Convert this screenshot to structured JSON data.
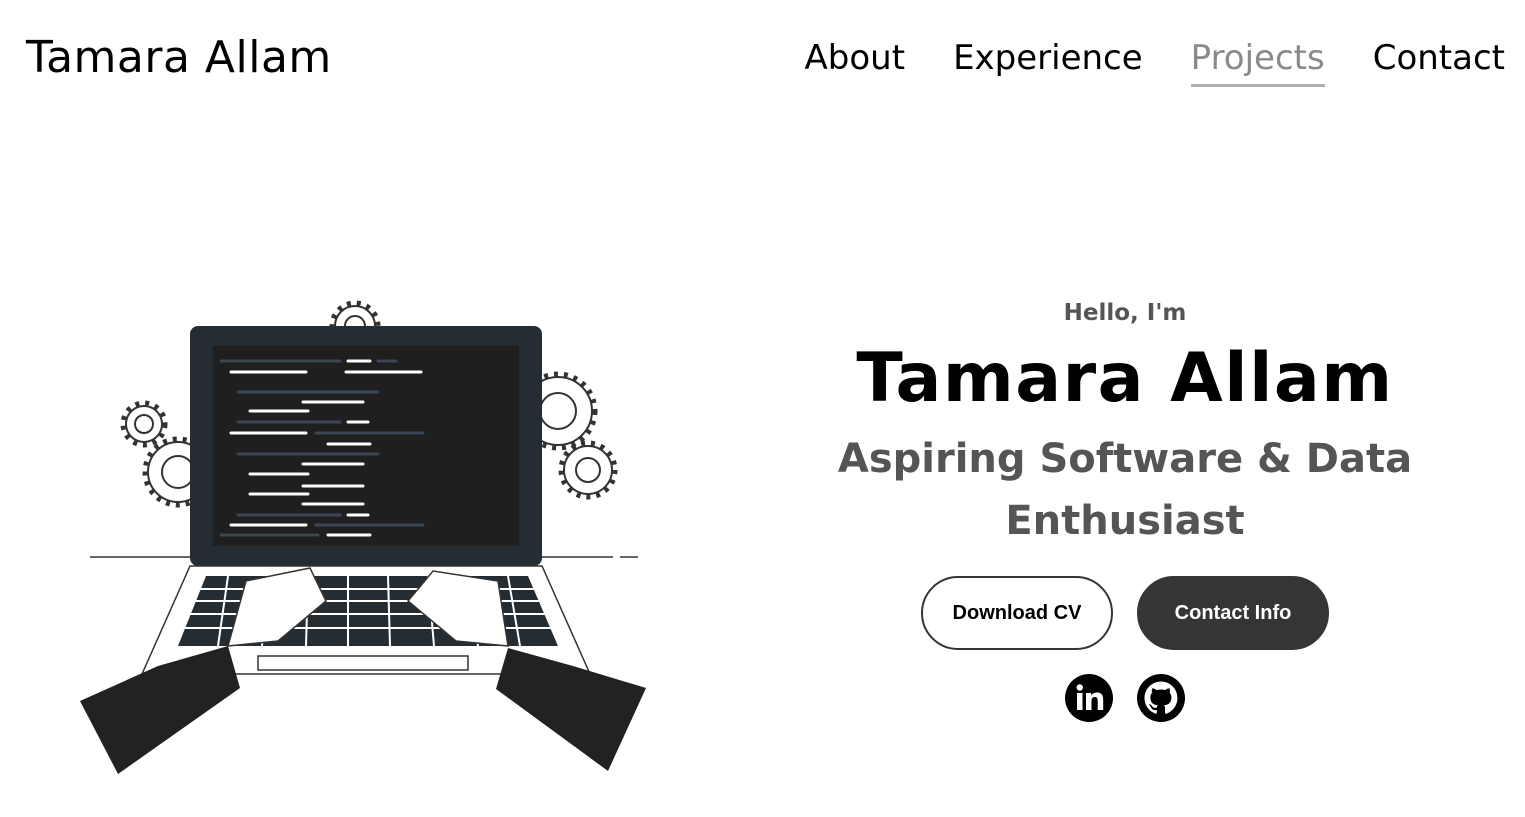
{
  "header": {
    "logo": "Tamara Allam",
    "nav": [
      {
        "label": "About",
        "active": false
      },
      {
        "label": "Experience",
        "active": false
      },
      {
        "label": "Projects",
        "active": true
      },
      {
        "label": "Contact",
        "active": false
      }
    ]
  },
  "hero": {
    "greeting": "Hello, I'm",
    "name": "Tamara Allam",
    "tagline_line1": "Aspiring Software & Data",
    "tagline_line2": "Enthusiast",
    "buttons": {
      "download_cv": "Download CV",
      "contact_info": "Contact Info"
    },
    "socials": [
      {
        "icon": "linkedin-icon"
      },
      {
        "icon": "github-icon"
      }
    ],
    "illustration": "laptop-coding-illustration"
  },
  "colors": {
    "text": "#000000",
    "muted": "#555555",
    "active_nav": "#8a8a8a",
    "button_dark": "#353535",
    "laptop_body": "#252d33",
    "screen": "#1f1f1f"
  }
}
